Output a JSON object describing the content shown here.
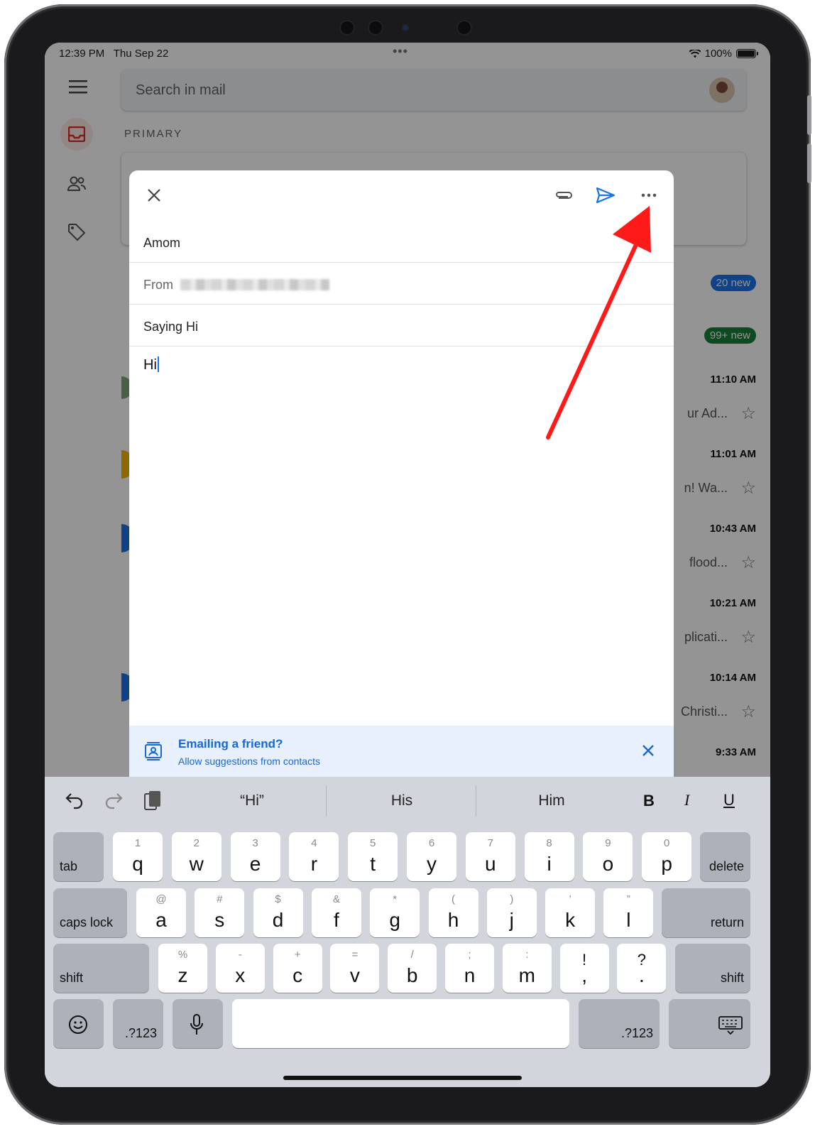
{
  "status_bar": {
    "time": "12:39 PM",
    "date": "Thu Sep 22",
    "battery": "100%"
  },
  "background_app": {
    "search_placeholder": "Search in mail",
    "section_label": "PRIMARY",
    "badges": [
      {
        "text": "20 new",
        "color": "#1a73e8"
      },
      {
        "text": "99+ new",
        "color": "#188038"
      }
    ],
    "mail_rows": [
      {
        "time": "11:10 AM",
        "preview": "ur Ad..."
      },
      {
        "time": "11:01 AM",
        "preview": "n! Wa..."
      },
      {
        "time": "10:43 AM",
        "preview": "flood..."
      },
      {
        "time": "10:21 AM",
        "preview": "plicati..."
      },
      {
        "time": "10:14 AM",
        "preview": "Christi..."
      },
      {
        "time": "9:33 AM",
        "preview": ""
      }
    ]
  },
  "compose": {
    "to": "Amom",
    "from_label": "From",
    "subject": "Saying Hi",
    "body": "Hi",
    "banner": {
      "title": "Emailing a friend?",
      "subtitle": "Allow suggestions from contacts"
    },
    "icons": {
      "close": "close-icon",
      "attach": "paperclip-icon",
      "send": "send-icon",
      "more": "more-horizontal-icon"
    },
    "accent": "#1a73e8",
    "annotation_arrow_color": "#ff1a1a"
  },
  "keyboard": {
    "suggestions": [
      "“Hi”",
      "His",
      "Him"
    ],
    "format": {
      "bold": "B",
      "italic": "I",
      "underline": "U"
    },
    "row1": [
      {
        "k": "q",
        "s": "1"
      },
      {
        "k": "w",
        "s": "2"
      },
      {
        "k": "e",
        "s": "3"
      },
      {
        "k": "r",
        "s": "4"
      },
      {
        "k": "t",
        "s": "5"
      },
      {
        "k": "y",
        "s": "6"
      },
      {
        "k": "u",
        "s": "7"
      },
      {
        "k": "i",
        "s": "8"
      },
      {
        "k": "o",
        "s": "9"
      },
      {
        "k": "p",
        "s": "0"
      }
    ],
    "row2": [
      {
        "k": "a",
        "s": "@"
      },
      {
        "k": "s",
        "s": "#"
      },
      {
        "k": "d",
        "s": "$"
      },
      {
        "k": "f",
        "s": "&"
      },
      {
        "k": "g",
        "s": "*"
      },
      {
        "k": "h",
        "s": "("
      },
      {
        "k": "j",
        "s": ")"
      },
      {
        "k": "k",
        "s": "’"
      },
      {
        "k": "l",
        "s": "”"
      }
    ],
    "row3": [
      {
        "k": "z",
        "s": "%"
      },
      {
        "k": "x",
        "s": "-"
      },
      {
        "k": "c",
        "s": "+"
      },
      {
        "k": "v",
        "s": "="
      },
      {
        "k": "b",
        "s": "/"
      },
      {
        "k": "n",
        "s": ";"
      },
      {
        "k": "m",
        "s": ":"
      },
      {
        "k": ",",
        "s": "!"
      },
      {
        "k": ".",
        "s": "?"
      }
    ],
    "tab": "tab",
    "delete": "delete",
    "caps_lock": "caps lock",
    "return": "return",
    "shift": "shift",
    "num_left": ".?123",
    "num_right": ".?123"
  }
}
